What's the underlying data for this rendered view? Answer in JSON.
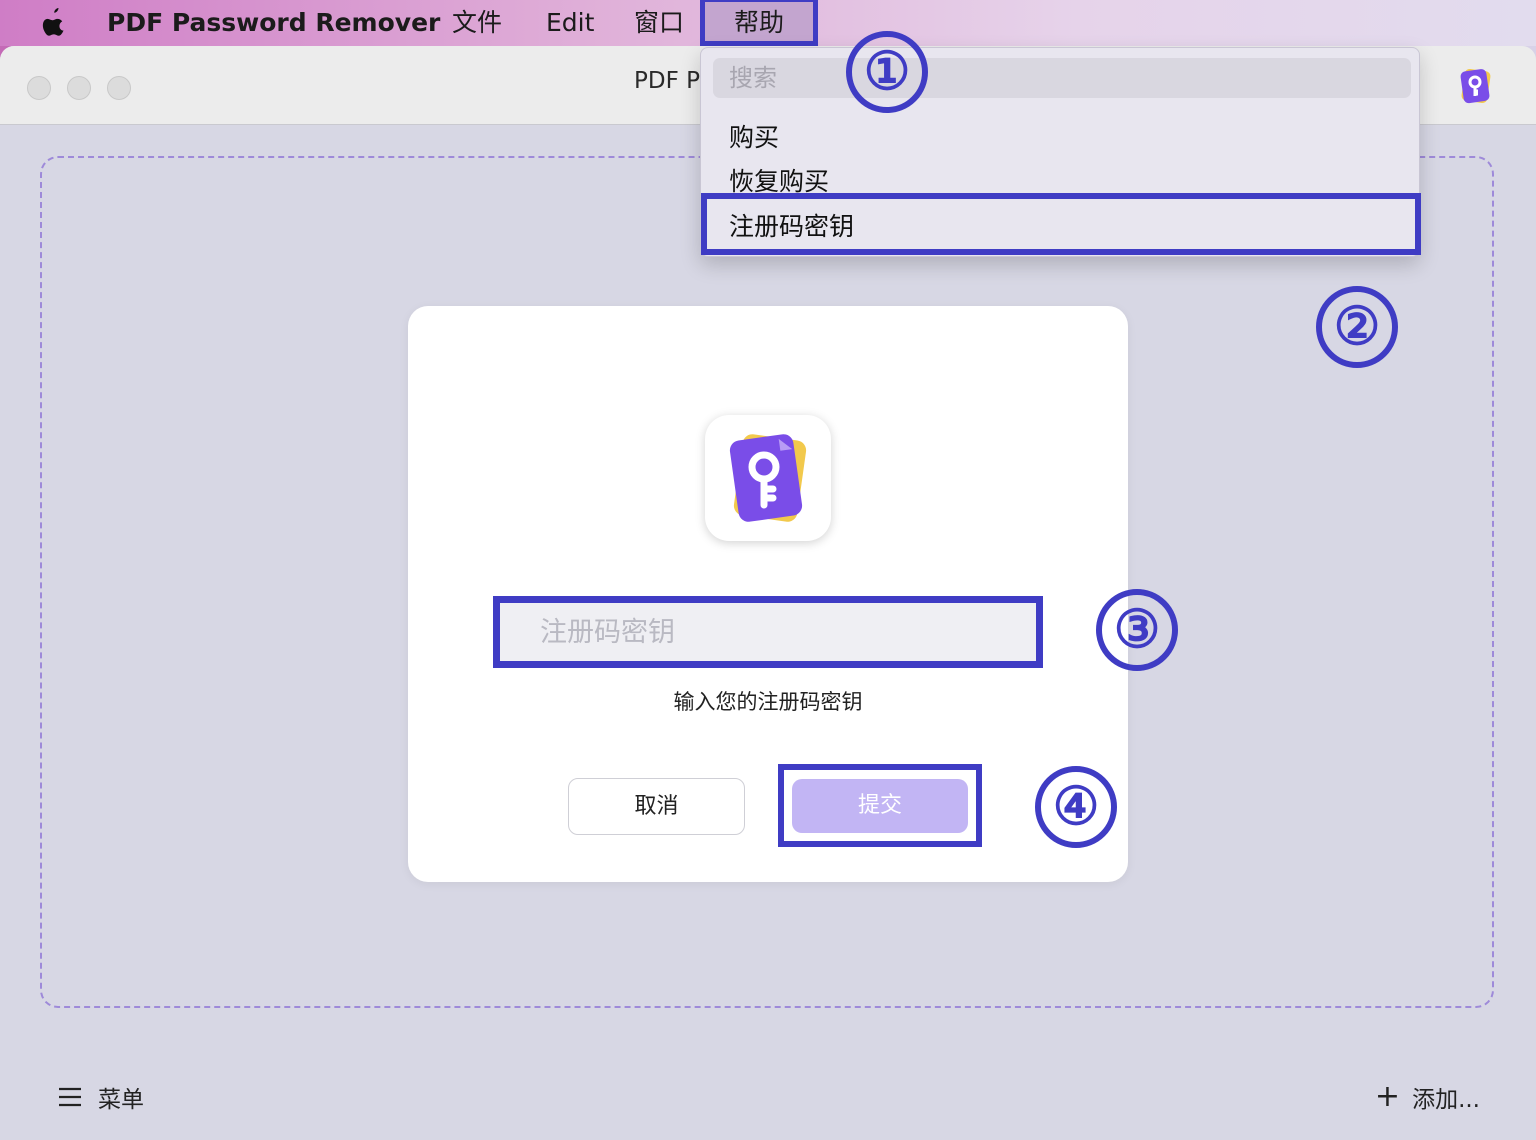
{
  "menubar": {
    "apple_glyph": "",
    "app_name": "PDF Password Remover",
    "file": "文件",
    "edit": "Edit",
    "window": "窗口",
    "help": "帮助"
  },
  "window": {
    "title": "PDF P",
    "bottom": {
      "menu_label": "菜单",
      "add_label": "添加..."
    }
  },
  "dropdown": {
    "search_placeholder": "搜索",
    "buy": "购买",
    "restore": "恢复购买",
    "register": "注册码密钥"
  },
  "dialog": {
    "key_placeholder": "注册码密钥",
    "hint": "输入您的注册码密钥",
    "cancel": "取消",
    "submit": "提交"
  },
  "annotations": [
    "①",
    "②",
    "③",
    "④"
  ],
  "colors": {
    "annotation": "#3f3cc4",
    "submit_disabled": "#c2b5f4",
    "icon_purple": "#7a4de8",
    "icon_yellow": "#f2c94c"
  }
}
